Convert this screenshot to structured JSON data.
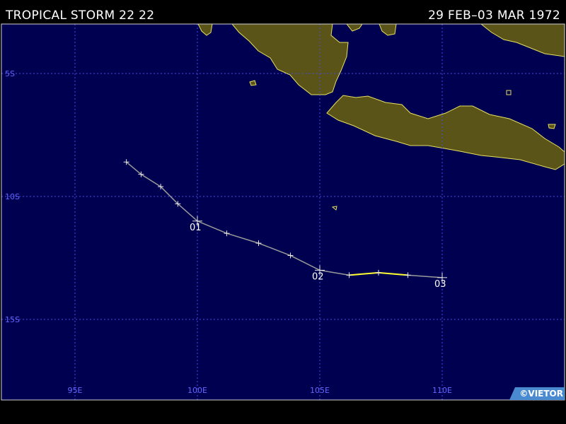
{
  "header": {
    "storm_name": "TROPICAL STORM 22 22",
    "date_range": "29 FEB–03 MAR 1972"
  },
  "colors": {
    "ocean": "#000050",
    "land": "#5a5418",
    "coast": "#e8e060",
    "grid": "#4a4ae6",
    "grid_label": "#6666ff",
    "track_weak": "#9a9a9a",
    "track_storm": "#ffff30",
    "frame": "#d0d0d0"
  },
  "map": {
    "lat_labels": [
      "5S",
      "10S",
      "15S"
    ],
    "lon_labels": [
      "95E",
      "100E",
      "105E",
      "110E"
    ]
  },
  "track": {
    "day_labels": [
      "01",
      "02",
      "03"
    ],
    "points": [
      {
        "lon": 97.1,
        "lat": -8.6,
        "stage": "depression"
      },
      {
        "lon": 97.7,
        "lat": -9.1,
        "stage": "depression"
      },
      {
        "lon": 98.5,
        "lat": -9.6,
        "stage": "depression"
      },
      {
        "lon": 99.2,
        "lat": -10.3,
        "stage": "depression"
      },
      {
        "lon": 100.0,
        "lat": -11.0,
        "stage": "depression"
      },
      {
        "lon": 101.2,
        "lat": -11.5,
        "stage": "depression"
      },
      {
        "lon": 102.5,
        "lat": -11.9,
        "stage": "depression"
      },
      {
        "lon": 103.8,
        "lat": -12.4,
        "stage": "depression"
      },
      {
        "lon": 105.0,
        "lat": -13.0,
        "stage": "depression"
      },
      {
        "lon": 106.2,
        "lat": -13.2,
        "stage": "storm"
      },
      {
        "lon": 107.4,
        "lat": -13.1,
        "stage": "storm"
      },
      {
        "lon": 108.6,
        "lat": -13.2,
        "stage": "storm"
      },
      {
        "lon": 110.0,
        "lat": -13.3,
        "stage": "depression"
      }
    ]
  },
  "credit": "©VIETOR"
}
